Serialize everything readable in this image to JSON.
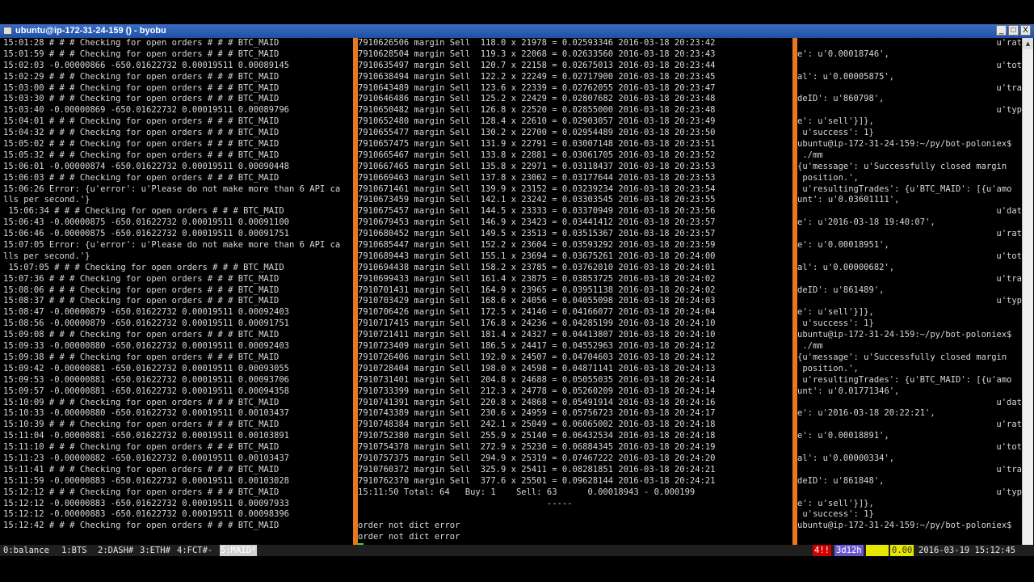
{
  "window": {
    "title": "ubuntu@ip-172-31-24-159 () - byobu",
    "minimize": "_",
    "maximize": "□",
    "close": "X"
  },
  "pane1_lines": [
    "15:01:28 # # # Checking for open orders # # # BTC_MAID",
    "15:01:59 # # # Checking for open orders # # # BTC_MAID",
    "15:02:03 -0.00000866 -650.01622732 0.00019511 0.00089145",
    "15:02:29 # # # Checking for open orders # # # BTC_MAID",
    "15:03:00 # # # Checking for open orders # # # BTC_MAID",
    "15:03:30 # # # Checking for open orders # # # BTC_MAID",
    "15:03:40 -0.00000869 -650.01622732 0.00019511 0.00089796",
    "15:04:01 # # # Checking for open orders # # # BTC_MAID",
    "15:04:32 # # # Checking for open orders # # # BTC_MAID",
    "15:05:02 # # # Checking for open orders # # # BTC_MAID",
    "15:05:32 # # # Checking for open orders # # # BTC_MAID",
    "15:06:01 -0.00000874 -650.01622732 0.00019511 0.00090448",
    "15:06:03 # # # Checking for open orders # # # BTC_MAID",
    "15:06:26 Error: {u'error': u'Please do not make more than 6 API ca",
    "lls per second.'}",
    " 15:06:34 # # # Checking for open orders # # # BTC_MAID",
    "15:06:43 -0.00000875 -650.01622732 0.00019511 0.00091100",
    "15:06:46 -0.00000875 -650.01622732 0.00019511 0.00091751",
    "15:07:05 Error: {u'error': u'Please do not make more than 6 API ca",
    "lls per second.'}",
    " 15:07:05 # # # Checking for open orders # # # BTC_MAID",
    "15:07:36 # # # Checking for open orders # # # BTC_MAID",
    "15:08:06 # # # Checking for open orders # # # BTC_MAID",
    "15:08:37 # # # Checking for open orders # # # BTC_MAID",
    "15:08:47 -0.00000879 -650.01622732 0.00019511 0.00092403",
    "15:08:56 -0.00000879 -650.01622732 0.00019511 0.00091751",
    "15:09:08 # # # Checking for open orders # # # BTC_MAID",
    "15:09:33 -0.00000880 -650.01622732 0.00019511 0.00092403",
    "15:09:38 # # # Checking for open orders # # # BTC_MAID",
    "15:09:42 -0.00000881 -650.01622732 0.00019511 0.00093055",
    "15:09:53 -0.00000881 -650.01622732 0.00019511 0.00093706",
    "15:09:57 -0.00000881 -650.01622732 0.00019511 0.00094358",
    "15:10:09 # # # Checking for open orders # # # BTC_MAID",
    "15:10:33 -0.00000880 -650.01622732 0.00019511 0.00103437",
    "15:10:39 # # # Checking for open orders # # # BTC_MAID",
    "15:11:04 -0.00000881 -650.01622732 0.00019511 0.00103891",
    "15:11:10 # # # Checking for open orders # # # BTC_MAID",
    "15:11:23 -0.00000882 -650.01622732 0.00019511 0.00103437",
    "15:11:41 # # # Checking for open orders # # # BTC_MAID",
    "15:11:59 -0.00000883 -650.01622732 0.00019511 0.00103028",
    "15:12:12 # # # Checking for open orders # # # BTC_MAID",
    "15:12:12 -0.00000883 -650.01622732 0.00019511 0.00097933",
    "15:12:12 -0.00000883 -650.01622732 0.00019511 0.00098396",
    "15:12:42 # # # Checking for open orders # # # BTC_MAID"
  ],
  "pane2_lines": [
    "7910626506 margin Sell  118.0 x 21978 = 0.02593346 2016-03-18 20:23:42",
    "7910628504 margin Sell  119.3 x 22068 = 0.02633560 2016-03-18 20:23:43",
    "7910635497 margin Sell  120.7 x 22158 = 0.02675013 2016-03-18 20:23:44",
    "7910638494 margin Sell  122.2 x 22249 = 0.02717900 2016-03-18 20:23:45",
    "7910643489 margin Sell  123.6 x 22339 = 0.02762055 2016-03-18 20:23:47",
    "7910646486 margin Sell  125.2 x 22429 = 0.02807682 2016-03-18 20:23:48",
    "7910650482 margin Sell  126.8 x 22520 = 0.02855000 2016-03-18 20:23:48",
    "7910652480 margin Sell  128.4 x 22610 = 0.02903057 2016-03-18 20:23:49",
    "7910655477 margin Sell  130.2 x 22700 = 0.02954489 2016-03-18 20:23:50",
    "7910657475 margin Sell  131.9 x 22791 = 0.03007148 2016-03-18 20:23:51",
    "7910665467 margin Sell  133.8 x 22881 = 0.03061705 2016-03-18 20:23:52",
    "7910667465 margin Sell  135.8 x 22971 = 0.03118437 2016-03-18 20:23:53",
    "7910669463 margin Sell  137.8 x 23062 = 0.03177644 2016-03-18 20:23:53",
    "7910671461 margin Sell  139.9 x 23152 = 0.03239234 2016-03-18 20:23:54",
    "7910673459 margin Sell  142.1 x 23242 = 0.03303545 2016-03-18 20:23:55",
    "7910675457 margin Sell  144.5 x 23333 = 0.03370949 2016-03-18 20:23:56",
    "7910679453 margin Sell  146.9 x 23423 = 0.03441412 2016-03-18 20:23:57",
    "7910680452 margin Sell  149.5 x 23513 = 0.03515367 2016-03-18 20:23:57",
    "7910685447 margin Sell  152.2 x 23604 = 0.03593292 2016-03-18 20:23:59",
    "7910689443 margin Sell  155.1 x 23694 = 0.03675261 2016-03-18 20:24:00",
    "7910694438 margin Sell  158.2 x 23785 = 0.03762010 2016-03-18 20:24:01",
    "7910699433 margin Sell  161.4 x 23875 = 0.03853725 2016-03-18 20:24:02",
    "7910701431 margin Sell  164.9 x 23965 = 0.03951138 2016-03-18 20:24:02",
    "7910703429 margin Sell  168.6 x 24056 = 0.04055098 2016-03-18 20:24:03",
    "7910706426 margin Sell  172.5 x 24146 = 0.04166077 2016-03-18 20:24:04",
    "7910717415 margin Sell  176.8 x 24236 = 0.04285199 2016-03-18 20:24:10",
    "7910721411 margin Sell  181.4 x 24327 = 0.04413807 2016-03-18 20:24:10",
    "7910723409 margin Sell  186.5 x 24417 = 0.04552963 2016-03-18 20:24:12",
    "7910726406 margin Sell  192.0 x 24507 = 0.04704603 2016-03-18 20:24:12",
    "7910728404 margin Sell  198.0 x 24598 = 0.04871141 2016-03-18 20:24:13",
    "7910731401 margin Sell  204.8 x 24688 = 0.05055035 2016-03-18 20:24:14",
    "7910733399 margin Sell  212.3 x 24778 = 0.05260209 2016-03-18 20:24:14",
    "7910741391 margin Sell  220.8 x 24868 = 0.05491914 2016-03-18 20:24:16",
    "7910743389 margin Sell  230.6 x 24959 = 0.05756723 2016-03-18 20:24:17",
    "7910748384 margin Sell  242.1 x 25049 = 0.06065002 2016-03-18 20:24:18",
    "7910752380 margin Sell  255.9 x 25140 = 0.06432534 2016-03-18 20:24:18",
    "7910754378 margin Sell  272.9 x 25230 = 0.06884345 2016-03-18 20:24:19",
    "7910757375 margin Sell  294.9 x 25319 = 0.07467222 2016-03-18 20:24:20",
    "7910760372 margin Sell  325.9 x 25411 = 0.08281851 2016-03-18 20:24:21",
    "7910762370 margin Sell  377.6 x 25501 = 0.09628144 2016-03-18 20:24:21",
    "15:11:50 Total: 64   Buy: 1    Sell: 63      0.00018943 - 0.000199",
    "                                     -----",
    "",
    "order not dict error",
    "order not dict error"
  ],
  "pane3_lines": [
    {
      "t": "u'rat",
      "r": true
    },
    {
      "t": "e': u'0.00018746',",
      "r": false
    },
    {
      "t": "u'tot",
      "r": true
    },
    {
      "t": "al': u'0.00005875',",
      "r": false
    },
    {
      "t": "u'tra",
      "r": true
    },
    {
      "t": "deID': u'860798',",
      "r": false
    },
    {
      "t": "u'typ",
      "r": true
    },
    {
      "t": "e': u'sell'}]},",
      "r": false
    },
    {
      "t": " u'success': 1}",
      "r": false
    },
    {
      "t": "ubuntu@ip-172-31-24-159:~/py/bot-poloniex$",
      "r": false
    },
    {
      "t": " ./mm",
      "r": false
    },
    {
      "t": "{u'message': u'Successfully closed margin",
      "r": false
    },
    {
      "t": " position.',",
      "r": false
    },
    {
      "t": " u'resultingTrades': {u'BTC_MAID': [{u'amo",
      "r": false
    },
    {
      "t": "unt': u'0.03601111',",
      "r": false
    },
    {
      "t": "u'dat",
      "r": true
    },
    {
      "t": "e': u'2016-03-18 19:40:07',",
      "r": false
    },
    {
      "t": "u'rat",
      "r": true
    },
    {
      "t": "e': u'0.00018951',",
      "r": false
    },
    {
      "t": "u'tot",
      "r": true
    },
    {
      "t": "al': u'0.00000682',",
      "r": false
    },
    {
      "t": "u'tra",
      "r": true
    },
    {
      "t": "deID': u'861489',",
      "r": false
    },
    {
      "t": "u'typ",
      "r": true
    },
    {
      "t": "e': u'sell'}]},",
      "r": false
    },
    {
      "t": " u'success': 1}",
      "r": false
    },
    {
      "t": "ubuntu@ip-172-31-24-159:~/py/bot-poloniex$",
      "r": false
    },
    {
      "t": " ./mm",
      "r": false
    },
    {
      "t": "{u'message': u'Successfully closed margin",
      "r": false
    },
    {
      "t": " position.',",
      "r": false
    },
    {
      "t": " u'resultingTrades': {u'BTC_MAID': [{u'amo",
      "r": false
    },
    {
      "t": "unt': u'0.01771346',",
      "r": false
    },
    {
      "t": "u'dat",
      "r": true
    },
    {
      "t": "e': u'2016-03-18 20:22:21',",
      "r": false
    },
    {
      "t": "u'rat",
      "r": true
    },
    {
      "t": "e': u'0.00018891',",
      "r": false
    },
    {
      "t": "u'tot",
      "r": true
    },
    {
      "t": "al': u'0.00000334',",
      "r": false
    },
    {
      "t": "u'tra",
      "r": true
    },
    {
      "t": "deID': u'861848',",
      "r": false
    },
    {
      "t": "u'typ",
      "r": true
    },
    {
      "t": "e': u'sell'}]},",
      "r": false
    },
    {
      "t": " u'success': 1}",
      "r": false
    },
    {
      "t": "ubuntu@ip-172-31-24-159:~/py/bot-poloniex$",
      "r": false
    }
  ],
  "statusbar": {
    "windows": [
      "0:balance",
      "1:BTS",
      "2:DASH#",
      "3:ETH#",
      "4:FCT#-",
      "5:MAID*"
    ],
    "alert": "4!!",
    "uptime": "3d12h",
    "load_box": "",
    "load": "0.00",
    "datetime": "2016-03-19 15:12:45"
  },
  "colors": {
    "divider": "#e87722",
    "cursor": "#3ed43e",
    "alert_bg": "#cc0000",
    "uptime_bg": "#6a5acd",
    "load_bg": "#e6e600",
    "active_window_bg": "#d0d0d0"
  }
}
